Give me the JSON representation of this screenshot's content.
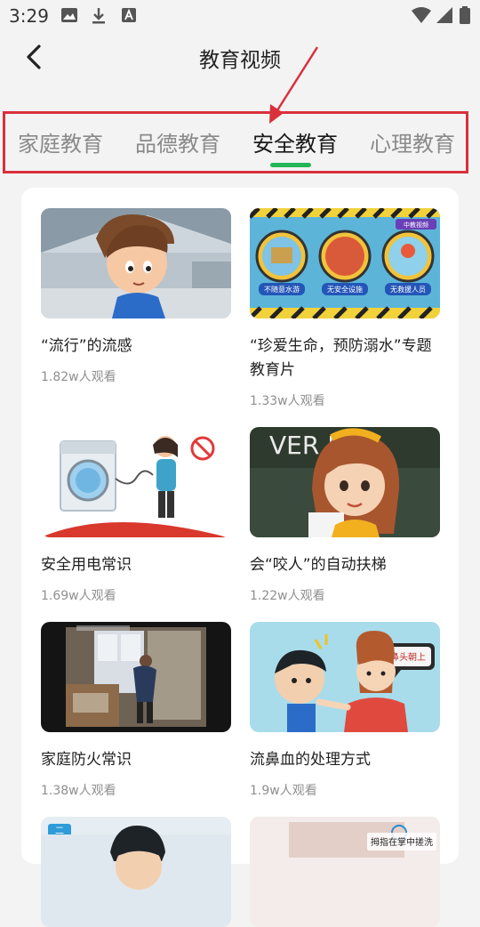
{
  "status_bar": {
    "time": "3:29"
  },
  "header": {
    "title": "教育视频"
  },
  "tabs": [
    {
      "label": "家庭教育",
      "active": false
    },
    {
      "label": "品德教育",
      "active": false
    },
    {
      "label": "安全教育",
      "active": true
    },
    {
      "label": "心理教育",
      "active": false
    }
  ],
  "accent_color": "#22b55a",
  "annotation_color": "#d9303c",
  "videos": [
    {
      "title": "“流行”的流感",
      "views": "1.82w人观看"
    },
    {
      "title": "“珍爱生命，预防溺水”专题教育片",
      "views": "1.33w人观看",
      "thumb_text": {
        "badge": "中教视频",
        "sign1": "不随意水游",
        "sign2": "无安全设施",
        "sign3": "无救援人员"
      }
    },
    {
      "title": "安全用电常识",
      "views": "1.69w人观看"
    },
    {
      "title": "会“咬人”的自动扶梯",
      "views": "1.22w人观看",
      "thumb_text": {
        "sign": "VER   BTE"
      }
    },
    {
      "title": "家庭防火常识",
      "views": "1.38w人观看"
    },
    {
      "title": "流鼻血的处理方式",
      "views": "1.9w人观看",
      "thumb_text": {
        "bubble": "鼻头朝上"
      }
    },
    {
      "thumb_text": {
        "badge": "二"
      }
    },
    {
      "thumb_text": {
        "caption": "拇指在掌中搓洗"
      }
    }
  ]
}
